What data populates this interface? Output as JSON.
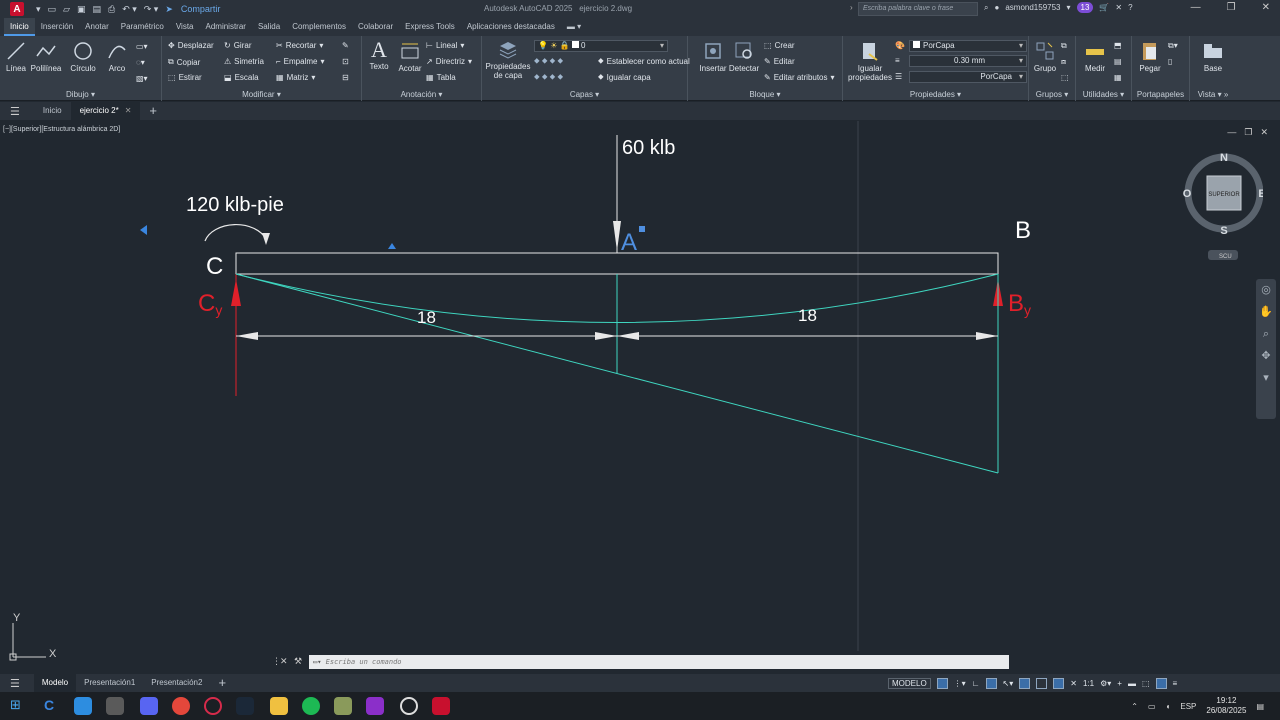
{
  "titlebar": {
    "logo": "A",
    "share_label": "Compartir",
    "app_title": "Autodesk AutoCAD 2025",
    "file_title": "ejercicio 2.dwg",
    "search_placeholder": "Escriba palabra clave o frase",
    "username": "asmond159753",
    "notif_count": "13"
  },
  "ribbon_tabs": [
    "Inicio",
    "Inserción",
    "Anotar",
    "Paramétrico",
    "Vista",
    "Administrar",
    "Salida",
    "Complementos",
    "Colaborar",
    "Express Tools",
    "Aplicaciones destacadas"
  ],
  "ribbon": {
    "dibujo": {
      "title": "Dibujo",
      "linea": "Línea",
      "polilinea": "Polilínea",
      "circulo": "Círculo",
      "arco": "Arco"
    },
    "modificar": {
      "title": "Modificar",
      "desplazar": "Desplazar",
      "girar": "Girar",
      "recortar": "Recortar",
      "copiar": "Copiar",
      "simetria": "Simetría",
      "empalme": "Empalme",
      "estirar": "Estirar",
      "escala": "Escala",
      "matriz": "Matriz"
    },
    "anotacion": {
      "title": "Anotación",
      "texto": "Texto",
      "acotar": "Acotar",
      "lineal": "Lineal",
      "directriz": "Directriz",
      "tabla": "Tabla"
    },
    "capas": {
      "title": "Capas",
      "propiedades": "Propiedades",
      "propiedades2": "de capa",
      "layer_value": "0",
      "establecer": "Establecer como actual",
      "igualar": "Igualar capa"
    },
    "bloque": {
      "title": "Bloque",
      "insertar": "Insertar",
      "detectar": "Detectar",
      "crear": "Crear",
      "editar": "Editar",
      "editar_atributos": "Editar atributos"
    },
    "propiedades": {
      "title": "Propiedades",
      "igualar": "Igualar",
      "igualar2": "propiedades",
      "color": "PorCapa",
      "lineweight": "0.30 mm",
      "linetype": "PorCapa"
    },
    "grupos": {
      "title": "Grupos",
      "grupo": "Grupo"
    },
    "utilidades": {
      "title": "Utilidades",
      "medir": "Medir"
    },
    "portapapeles": {
      "title": "Portapapeles",
      "pegar": "Pegar"
    },
    "vista": {
      "title": "Vista",
      "base": "Base"
    }
  },
  "doctabs": {
    "inicio": "Inicio",
    "active": "ejercicio 2*"
  },
  "viewport": {
    "label": "[−][Superior][Estructura alámbrica 2D]",
    "viewcube": {
      "n": "N",
      "s": "S",
      "e": "E",
      "o": "O",
      "face": "SUPERIOR",
      "ucs": "SCU"
    }
  },
  "drawing": {
    "load_label": "60 klb",
    "moment_label": "120 klb-pie",
    "point_c": "C",
    "point_b": "B",
    "point_a": "A",
    "reaction_c": "C",
    "reaction_c_sub": "y",
    "reaction_b": "B",
    "reaction_b_sub": "y",
    "dim_left": "18",
    "dim_right": "18",
    "axis_y": "Y",
    "axis_x": "X",
    "colors": {
      "line": "#e8e8e8",
      "cyan": "#3fd6c0",
      "red": "#e0202a",
      "blue": "#4f8fe0"
    }
  },
  "command": {
    "placeholder": "Escriba un comando"
  },
  "statusbar": {
    "tabs": [
      "Modelo",
      "Presentación1",
      "Presentación2"
    ],
    "modelo": "MODELO",
    "scale": "1:1"
  },
  "taskbar": {
    "lang": "ESP",
    "time": "19:12",
    "date": "26/08/2025"
  }
}
